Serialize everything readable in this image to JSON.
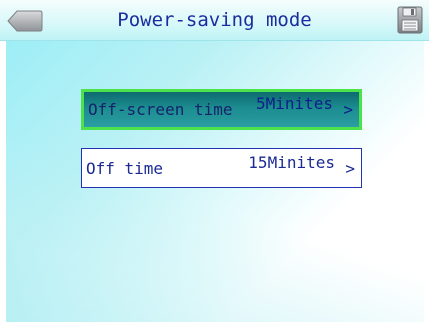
{
  "header": {
    "title": "Power-saving mode",
    "back_icon": "back-arrow-icon",
    "save_icon": "save-floppy-icon"
  },
  "settings": [
    {
      "label": "Off-screen time",
      "value": "5Minites",
      "chevron": ">",
      "selected": true
    },
    {
      "label": "Off time",
      "value": "15Minites",
      "chevron": ">",
      "selected": false
    }
  ],
  "colors": {
    "title_text": "#1a2da0",
    "selected_border": "#4be24b",
    "selected_background": "#1c8c90",
    "item_border": "#2232b0",
    "background_cyan": "#9eeef6"
  }
}
